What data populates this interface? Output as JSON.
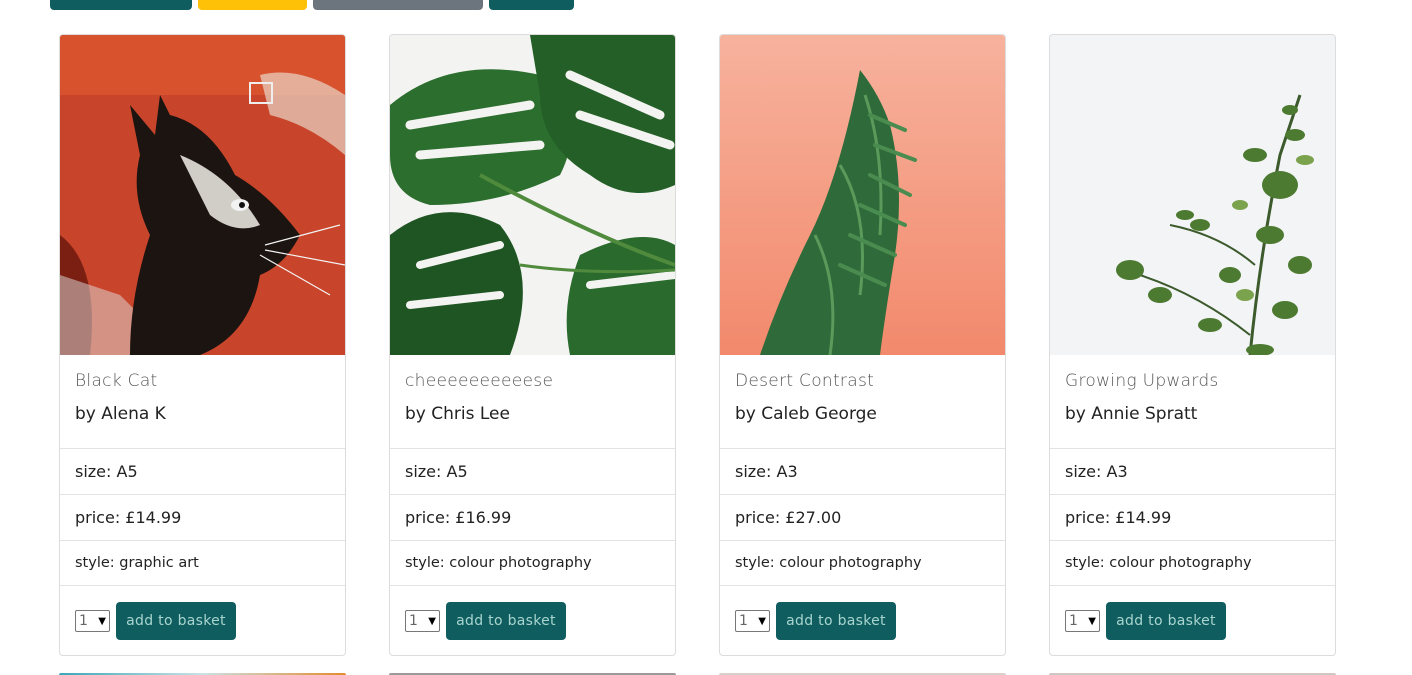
{
  "top_buttons": [
    {
      "name": "top-button-1",
      "color": "#105d5f"
    },
    {
      "name": "top-button-2",
      "color": "#ffc107"
    },
    {
      "name": "top-button-3",
      "color": "#6c757d"
    },
    {
      "name": "top-button-4",
      "color": "#105d5f"
    }
  ],
  "labels": {
    "size": "size: ",
    "price": "price: ",
    "style": "style: ",
    "add_to_basket": "add to basket"
  },
  "products": [
    {
      "title": "Black Cat",
      "artist": "by Alena K",
      "size": "A5",
      "price": "£14.99",
      "style": "graphic art",
      "qty": "1"
    },
    {
      "title": "cheeeeeeeeeese",
      "artist": "by Chris Lee",
      "size": "A5",
      "price": "£16.99",
      "style": "colour photography",
      "qty": "1"
    },
    {
      "title": "Desert Contrast",
      "artist": "by Caleb George",
      "size": "A3",
      "price": "£27.00",
      "style": "colour photography",
      "qty": "1"
    },
    {
      "title": "Growing Upwards",
      "artist": "by Annie Spratt",
      "size": "A3",
      "price": "£14.99",
      "style": "colour photography",
      "qty": "1"
    }
  ],
  "colors": {
    "accent": "#105d5f",
    "accent_text": "#a8d5cf"
  }
}
